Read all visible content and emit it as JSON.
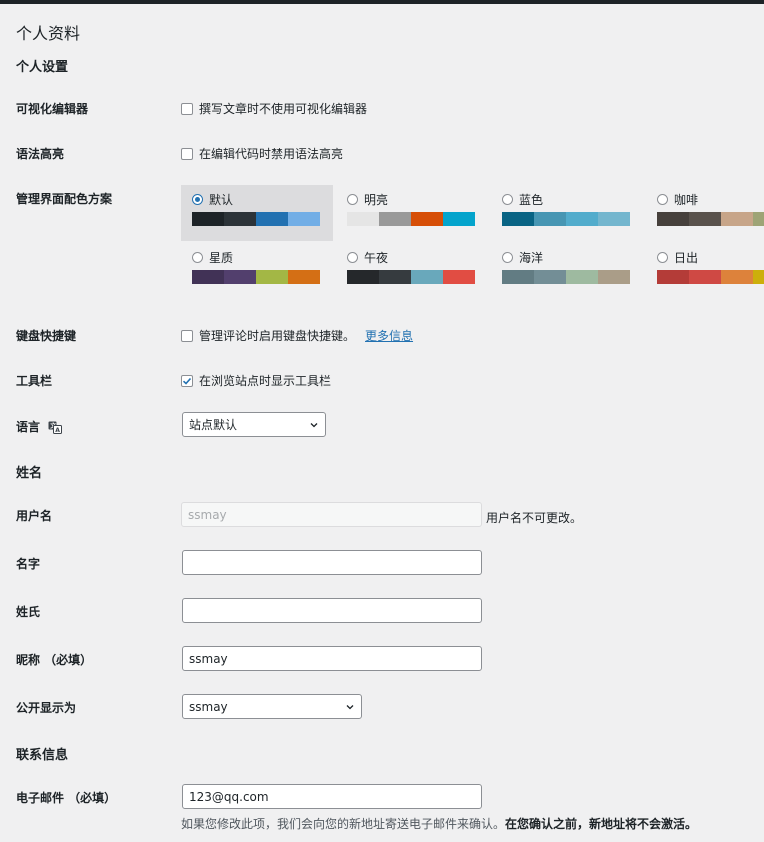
{
  "page": {
    "title": "个人资料"
  },
  "sections": {
    "personal": "个人设置",
    "name": "姓名",
    "contact": "联系信息"
  },
  "visual_editor": {
    "label": "可视化编辑器",
    "checkbox_text": "撰写文章时不使用可视化编辑器",
    "checked": false
  },
  "syntax": {
    "label": "语法高亮",
    "checkbox_text": "在编辑代码时禁用语法高亮",
    "checked": false
  },
  "color_scheme": {
    "label": "管理界面配色方案",
    "schemes": [
      {
        "name": "默认",
        "selected": true,
        "colors": [
          "#1d2327",
          "#2c3338",
          "#2271b1",
          "#72aee6"
        ]
      },
      {
        "name": "明亮",
        "selected": false,
        "colors": [
          "#e5e5e5",
          "#999999",
          "#d64e07",
          "#04a4cc"
        ]
      },
      {
        "name": "蓝色",
        "selected": false,
        "colors": [
          "#096484",
          "#4796b3",
          "#52accc",
          "#74b6ce"
        ]
      },
      {
        "name": "咖啡",
        "selected": false,
        "colors": [
          "#46403c",
          "#59524c",
          "#c7a589",
          "#9ea476"
        ]
      },
      {
        "name": "星质",
        "selected": false,
        "colors": [
          "#413256",
          "#523f6d",
          "#a3b745",
          "#d46f15"
        ]
      },
      {
        "name": "午夜",
        "selected": false,
        "colors": [
          "#25282b",
          "#363b3f",
          "#69a8bb",
          "#e14d43"
        ]
      },
      {
        "name": "海洋",
        "selected": false,
        "colors": [
          "#627c83",
          "#738e96",
          "#9ebaa0",
          "#aa9d88"
        ]
      },
      {
        "name": "日出",
        "selected": false,
        "colors": [
          "#b43c38",
          "#cf4944",
          "#dd823b",
          "#ccaf0b"
        ]
      }
    ]
  },
  "keyboard": {
    "label": "键盘快捷键",
    "checkbox_text": "管理评论时启用键盘快捷键。",
    "link": "更多信息",
    "checked": false
  },
  "toolbar": {
    "label": "工具栏",
    "checkbox_text": "在浏览站点时显示工具栏",
    "checked": true
  },
  "language": {
    "label": "语言",
    "icon": "translate-icon",
    "value": "站点默认"
  },
  "username": {
    "label": "用户名",
    "value": "ssmay",
    "note": "用户名不可更改。"
  },
  "first_name": {
    "label": "名字",
    "value": ""
  },
  "last_name": {
    "label": "姓氏",
    "value": ""
  },
  "nickname": {
    "label": "昵称 （必填）",
    "value": "ssmay"
  },
  "display_name": {
    "label": "公开显示为",
    "value": "ssmay"
  },
  "email": {
    "label": "电子邮件 （必填）",
    "value": "123@qq.com",
    "note_plain": "如果您修改此项，我们会向您的新地址寄送电子邮件来确认。",
    "note_bold": "在您确认之前，新地址将不会激活。"
  }
}
